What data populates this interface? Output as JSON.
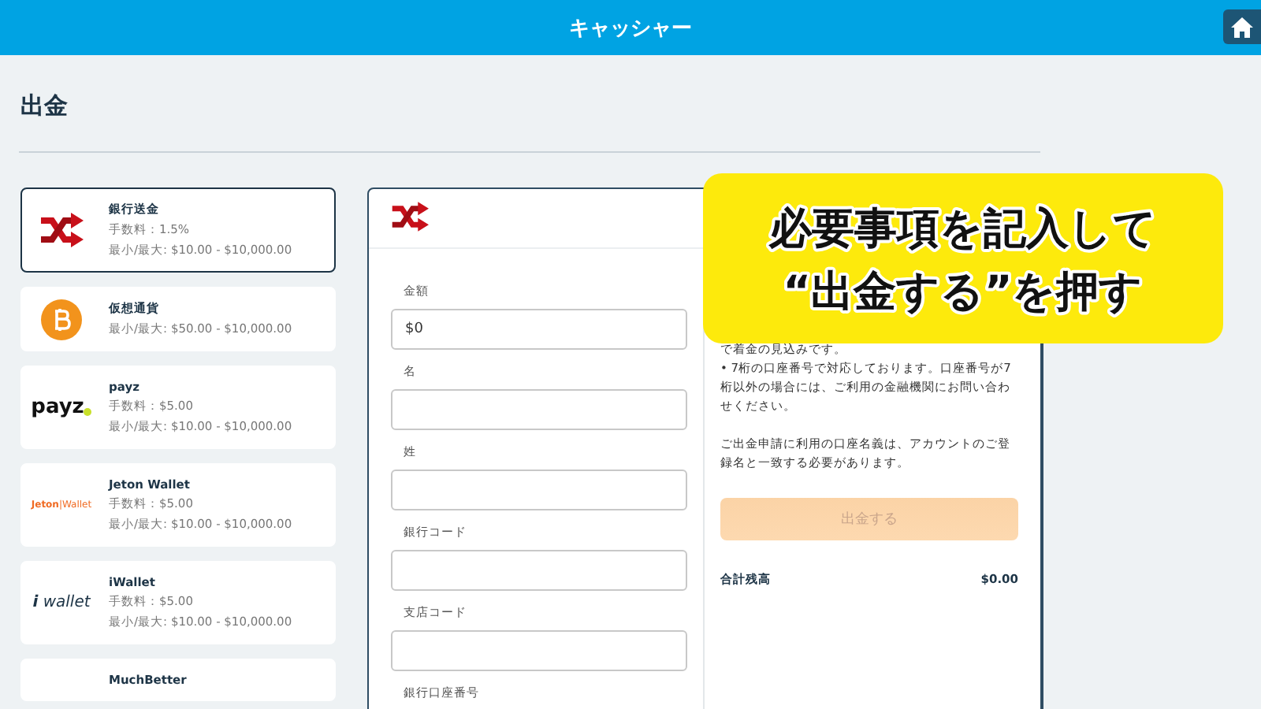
{
  "header": {
    "title": "キャッシャー"
  },
  "page_title": "出金",
  "methods": [
    {
      "kind": "bank",
      "name": "銀行送金",
      "fee": "手数料：1.5%",
      "range": "最小/最大: $10.00 - $10,000.00",
      "selected": true
    },
    {
      "kind": "bitcoin",
      "name": "仮想通貨",
      "range": "最小/最大: $50.00 - $10,000.00",
      "selected": false
    },
    {
      "kind": "payz",
      "logo_text": "payz",
      "name": "payz",
      "fee": "手数料：$5.00",
      "range": "最小/最大: $10.00 - $10,000.00",
      "selected": false
    },
    {
      "kind": "jeton",
      "logo_text": "Jeton",
      "logo_text_2": "|Wallet",
      "name": "Jeton Wallet",
      "fee": "手数料：$5.00",
      "range": "最小/最大: $10.00 - $10,000.00",
      "selected": false
    },
    {
      "kind": "iwallet",
      "logo_text": "i",
      "logo_text_2": "wallet",
      "name": "iWallet",
      "fee": "手数料：$5.00",
      "range": "最小/最大: $10.00 - $10,000.00",
      "selected": false
    },
    {
      "kind": "plain",
      "name": "MuchBetter",
      "selected": false
    }
  ],
  "form": {
    "fields": [
      {
        "label": "金額",
        "value": "$0"
      },
      {
        "label": "名"
      },
      {
        "label": "姓"
      },
      {
        "label": "銀行コード"
      },
      {
        "label": "支店コード"
      },
      {
        "label": "銀行口座番号"
      }
    ]
  },
  "notes": [
    "で着金の見込みです。",
    "• 7桁の口座番号で対応しております。口座番号が7桁以外の場合には、ご利用の金融機関にお問い合わせください。",
    "ご出金申請に利用の口座名義は、アカウントのご登録名と一致する必要があります。"
  ],
  "submit": {
    "label": "出金する",
    "disabled": true
  },
  "total": {
    "label": "合計残高",
    "value": "$0.00"
  },
  "callout": {
    "lines": [
      "必要事項を記入して",
      "“出金する”を押す"
    ]
  }
}
